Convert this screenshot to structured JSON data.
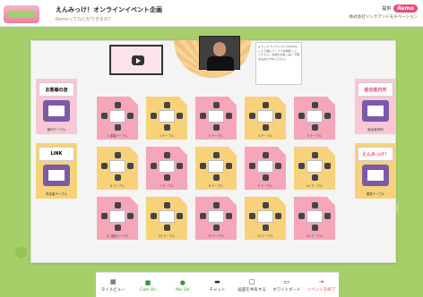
{
  "header": {
    "title": "えんみっけ！オンラインイベント企画",
    "subtitle": "Remoってなにができるの？",
    "brand_label": "提供",
    "brand_name": "Remo",
    "brand_small": "株式会社リンクアンドモチベーション"
  },
  "stage": {
    "notice": "ようこそ カメラとマイクをONにして 気軽にテーブルを移動 してください。お話をお楽しみに 不明点はおたずねください。"
  },
  "side_tables": [
    {
      "sign": "お客様の店",
      "label": "案内テーブル"
    },
    {
      "sign": "LiNK",
      "label": "内定者テーブル"
    },
    {
      "sign": "総合案内所",
      "label": "総合案内所"
    },
    {
      "sign": "えんみっけ！",
      "label": "運営テーブル"
    }
  ],
  "tables": [
    {
      "label": "1 接客テーブル"
    },
    {
      "label": "2 テーブル"
    },
    {
      "label": "3 テーブル"
    },
    {
      "label": "4 テーブル"
    },
    {
      "label": "5 テーブル"
    },
    {
      "label": "6 テーブル"
    },
    {
      "label": "7 テーブル"
    },
    {
      "label": "8 テーブル"
    },
    {
      "label": "9 テーブル"
    },
    {
      "label": "10 テーブル"
    },
    {
      "label": "11 雑談テーブル"
    },
    {
      "label": "12 テーブル"
    },
    {
      "label": "13 テーブル"
    },
    {
      "label": "14 テーブル"
    },
    {
      "label": "15 テーブル"
    }
  ],
  "toolbar": [
    {
      "icon": "grid-icon",
      "glyph": "▦",
      "label": "タイルビュー"
    },
    {
      "icon": "camera-icon",
      "glyph": "■",
      "label": "Cam On"
    },
    {
      "icon": "mic-icon",
      "glyph": "●",
      "label": "Mic On"
    },
    {
      "icon": "chat-icon",
      "glyph": "▬",
      "label": "チャット"
    },
    {
      "icon": "screen-share-icon",
      "glyph": "□",
      "label": "画面を共有する"
    },
    {
      "icon": "whiteboard-icon",
      "glyph": "▭",
      "label": "ホワイトボード"
    },
    {
      "icon": "leave-icon",
      "glyph": "⇥",
      "label": "イベントを終了"
    }
  ],
  "colors": {
    "pink": "#f6a6b9",
    "yellow": "#f8d27a",
    "accent": "#e84d7a",
    "green": "#2f9b3a"
  }
}
